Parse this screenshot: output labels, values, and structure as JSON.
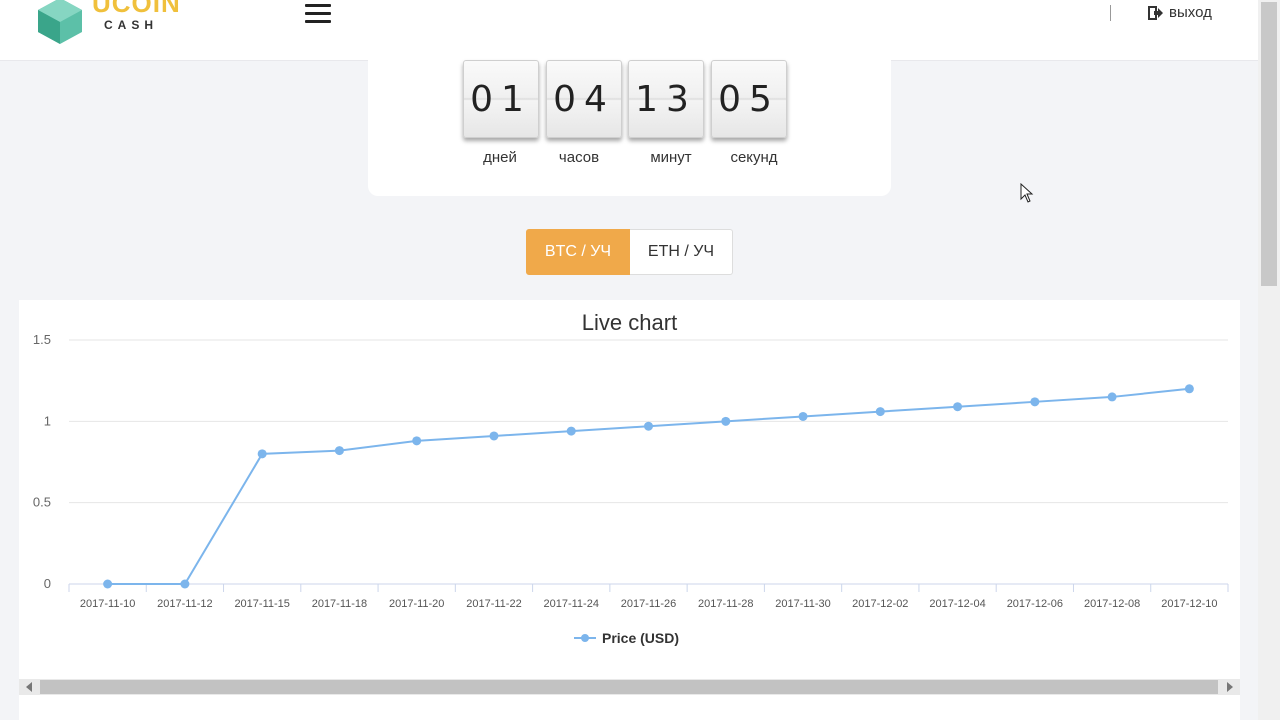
{
  "header": {
    "logo_word": "UCOIN",
    "logo_sub": "CASH",
    "logout_label": "выход"
  },
  "countdown": {
    "units": [
      {
        "value": "01",
        "label": "дней"
      },
      {
        "value": "04",
        "label": "часов"
      },
      {
        "value": "13",
        "label": "минут"
      },
      {
        "value": "05",
        "label": "секунд"
      }
    ]
  },
  "toggle": {
    "options": [
      {
        "label": "BTC / УЧ",
        "active": true
      },
      {
        "label": "ETH / УЧ",
        "active": false
      }
    ]
  },
  "colors": {
    "accent": "#f0a94a",
    "series": "#7cb5ec"
  },
  "chart_data": {
    "type": "line",
    "title": "Live chart",
    "xlabel": "",
    "ylabel": "",
    "categories": [
      "2017-11-10",
      "2017-11-12",
      "2017-11-15",
      "2017-11-18",
      "2017-11-20",
      "2017-11-22",
      "2017-11-24",
      "2017-11-26",
      "2017-11-28",
      "2017-11-30",
      "2017-12-02",
      "2017-12-04",
      "2017-12-06",
      "2017-12-08",
      "2017-12-10"
    ],
    "series": [
      {
        "name": "Price (USD)",
        "values": [
          0,
          0,
          0.8,
          0.82,
          0.88,
          0.91,
          0.94,
          0.97,
          1.0,
          1.03,
          1.06,
          1.09,
          1.12,
          1.15,
          1.2
        ]
      }
    ],
    "ylim": [
      0,
      1.5
    ],
    "yticks": [
      "0",
      "0.5",
      "1",
      "1.5"
    ],
    "grid": true,
    "legend_position": "bottom-center"
  }
}
